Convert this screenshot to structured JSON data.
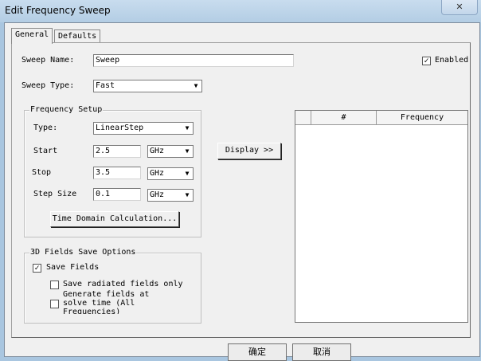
{
  "window": {
    "title": "Edit Frequency Sweep",
    "close_glyph": "✕"
  },
  "tabs": [
    {
      "label": "General"
    },
    {
      "label": "Defaults"
    }
  ],
  "general": {
    "sweep_name_label": "Sweep Name:",
    "sweep_name_value": "Sweep",
    "enabled_label": "Enabled",
    "enabled_checked": true,
    "sweep_type_label": "Sweep Type:",
    "sweep_type_value": "Fast",
    "freq_setup": {
      "title": "Frequency Setup",
      "type_label": "Type:",
      "type_value": "LinearStep",
      "start_label": "Start",
      "start_value": "2.5",
      "start_unit": "GHz",
      "stop_label": "Stop",
      "stop_value": "3.5",
      "stop_unit": "GHz",
      "step_label": "Step Size",
      "step_value": "0.1",
      "step_unit": "GHz",
      "time_domain_button": "Time Domain Calculation..."
    },
    "display_button": "Display >>",
    "table": {
      "col_hash": "#",
      "col_frequency": "Frequency"
    },
    "fields3d": {
      "title": "3D Fields Save Options",
      "save_fields_label": "Save Fields",
      "save_fields_checked": true,
      "save_radiated_label": "Save radiated fields only",
      "generate_label_line1": "Generate fields at",
      "generate_label_line2": "solve time (All",
      "generate_label_line3": "Frequencies)"
    }
  },
  "footer": {
    "ok_label": "确定",
    "cancel_label": "取消"
  },
  "icons": {
    "dropdown": "▼",
    "check": "✓"
  }
}
